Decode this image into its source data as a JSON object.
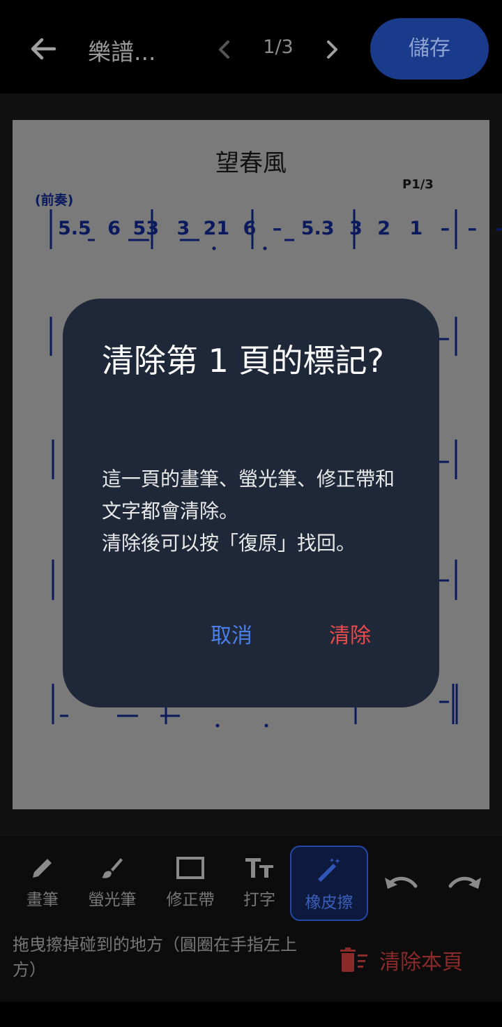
{
  "header": {
    "title": "樂譜...",
    "pager": "1/3",
    "save_label": "儲存"
  },
  "sheet": {
    "song_title": "望春風",
    "page_marker": "P1/3",
    "prelude": "(前奏)",
    "notation_line1": [
      "5.5",
      "6",
      "53",
      "3",
      "21",
      "6",
      "–",
      "5.3",
      "3",
      "2",
      "1",
      "–",
      "–",
      "–"
    ]
  },
  "toolbar": {
    "tools": [
      {
        "label": "畫筆",
        "icon": "pencil-icon"
      },
      {
        "label": "螢光筆",
        "icon": "brush-icon"
      },
      {
        "label": "修正帶",
        "icon": "rectangle-icon"
      },
      {
        "label": "打字",
        "icon": "text-size-icon"
      },
      {
        "label": "橡皮擦",
        "icon": "magic-eraser-icon",
        "active": true
      }
    ],
    "undo_icon": "undo-icon",
    "redo_icon": "redo-icon"
  },
  "hint": "拖曳擦掉碰到的地方（圓圈在手指左上方）",
  "clear_page_label": "清除本頁",
  "dialog": {
    "title": "清除第 1 頁的標記?",
    "body": "這一頁的畫筆、螢光筆、修正帶和文字都會清除。\n清除後可以按「復原」找回。",
    "cancel_label": "取消",
    "confirm_label": "清除"
  },
  "colors": {
    "accent": "#2448a8",
    "danger": "#ea4a4a",
    "dialog_bg": "#1f2838",
    "link_blue": "#4a7fe8"
  }
}
